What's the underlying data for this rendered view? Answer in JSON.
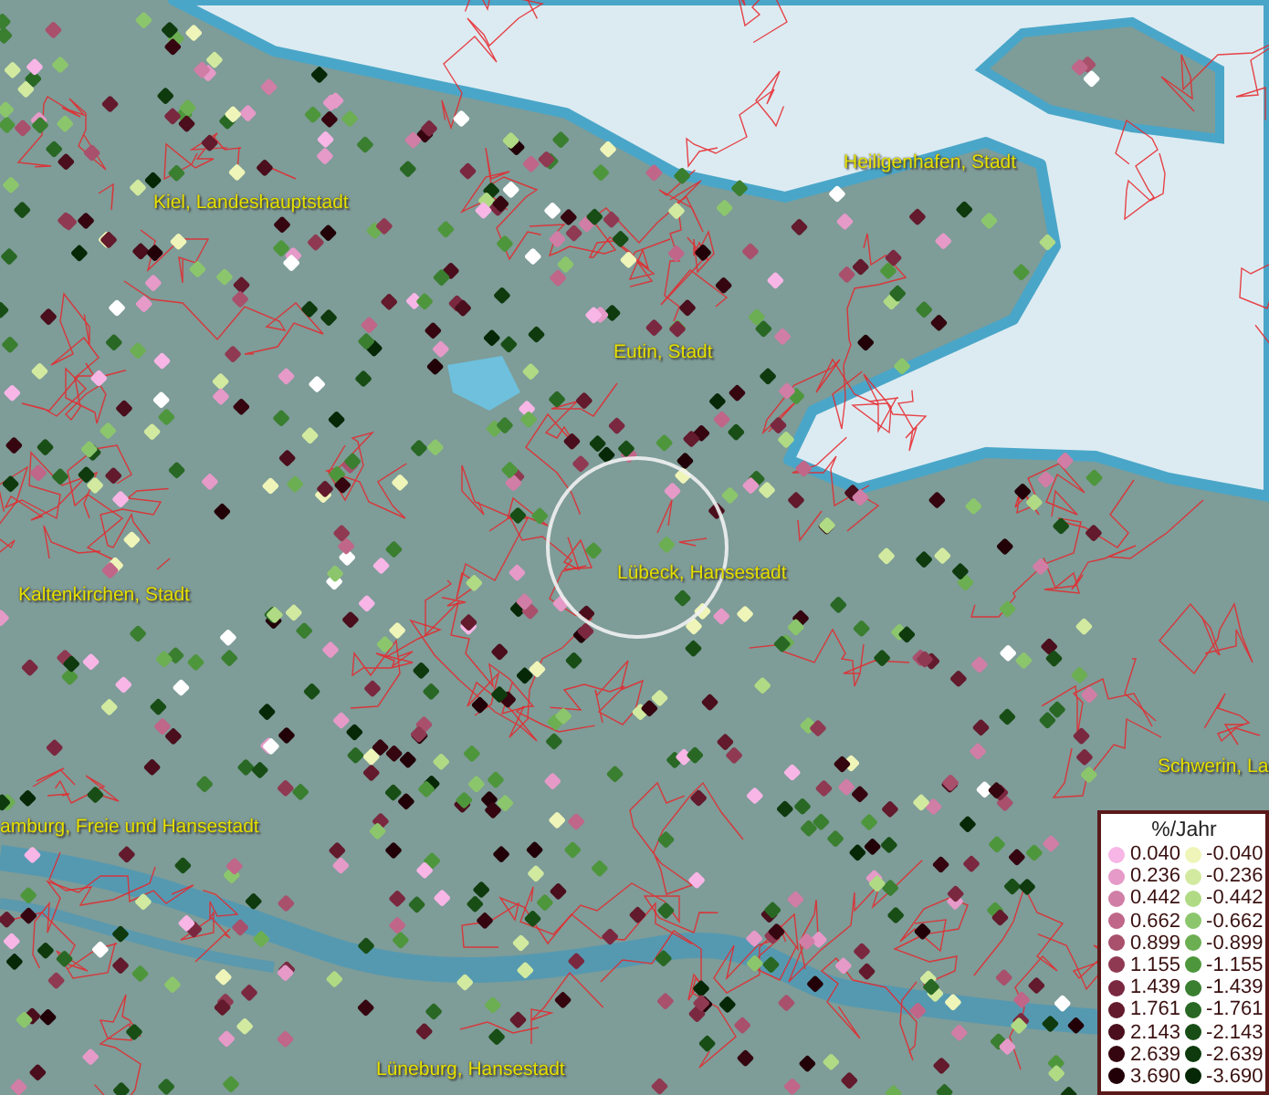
{
  "map": {
    "places": [
      {
        "name": "Heiligenhafen, Stadt"
      },
      {
        "name": "Kiel, Landeshauptstadt"
      },
      {
        "name": "Eutin, Stadt"
      },
      {
        "name": "Lübeck, Hansestadt"
      },
      {
        "name": "Kaltenkirchen, Stadt"
      },
      {
        "name": "Schwerin, La"
      },
      {
        "name": "amburg, Freie und Hansestadt"
      },
      {
        "name": "Lüneburg, Hansestadt"
      }
    ]
  },
  "legend": {
    "title": "%/Jahr",
    "rows": [
      {
        "positive": {
          "label": "0.040",
          "color": "#f7b6e6"
        },
        "negative": {
          "label": "-0.040",
          "color": "#eff5b8"
        }
      },
      {
        "positive": {
          "label": "0.236",
          "color": "#e59ac8"
        },
        "negative": {
          "label": "-0.236",
          "color": "#d2eaa0"
        }
      },
      {
        "positive": {
          "label": "0.442",
          "color": "#d07ea6"
        },
        "negative": {
          "label": "-0.442",
          "color": "#b0da84"
        }
      },
      {
        "positive": {
          "label": "0.662",
          "color": "#c06688"
        },
        "negative": {
          "label": "-0.662",
          "color": "#8cc66c"
        }
      },
      {
        "positive": {
          "label": "0.899",
          "color": "#a8506c"
        },
        "negative": {
          "label": "-0.899",
          "color": "#6cae52"
        }
      },
      {
        "positive": {
          "label": "1.155",
          "color": "#8f3a52"
        },
        "negative": {
          "label": "-1.155",
          "color": "#4e963c"
        }
      },
      {
        "positive": {
          "label": "1.439",
          "color": "#7a2840"
        },
        "negative": {
          "label": "-1.439",
          "color": "#3a7e30"
        }
      },
      {
        "positive": {
          "label": "1.761",
          "color": "#621a2c"
        },
        "negative": {
          "label": "-1.761",
          "color": "#286824"
        }
      },
      {
        "positive": {
          "label": "2.143",
          "color": "#4a0e1c"
        },
        "negative": {
          "label": "-2.143",
          "color": "#184e16"
        }
      },
      {
        "positive": {
          "label": "2.639",
          "color": "#350610"
        },
        "negative": {
          "label": "-2.639",
          "color": "#0e3a0e"
        }
      },
      {
        "positive": {
          "label": "3.690",
          "color": "#220008"
        },
        "negative": {
          "label": "-3.690",
          "color": "#062806"
        }
      }
    ]
  }
}
